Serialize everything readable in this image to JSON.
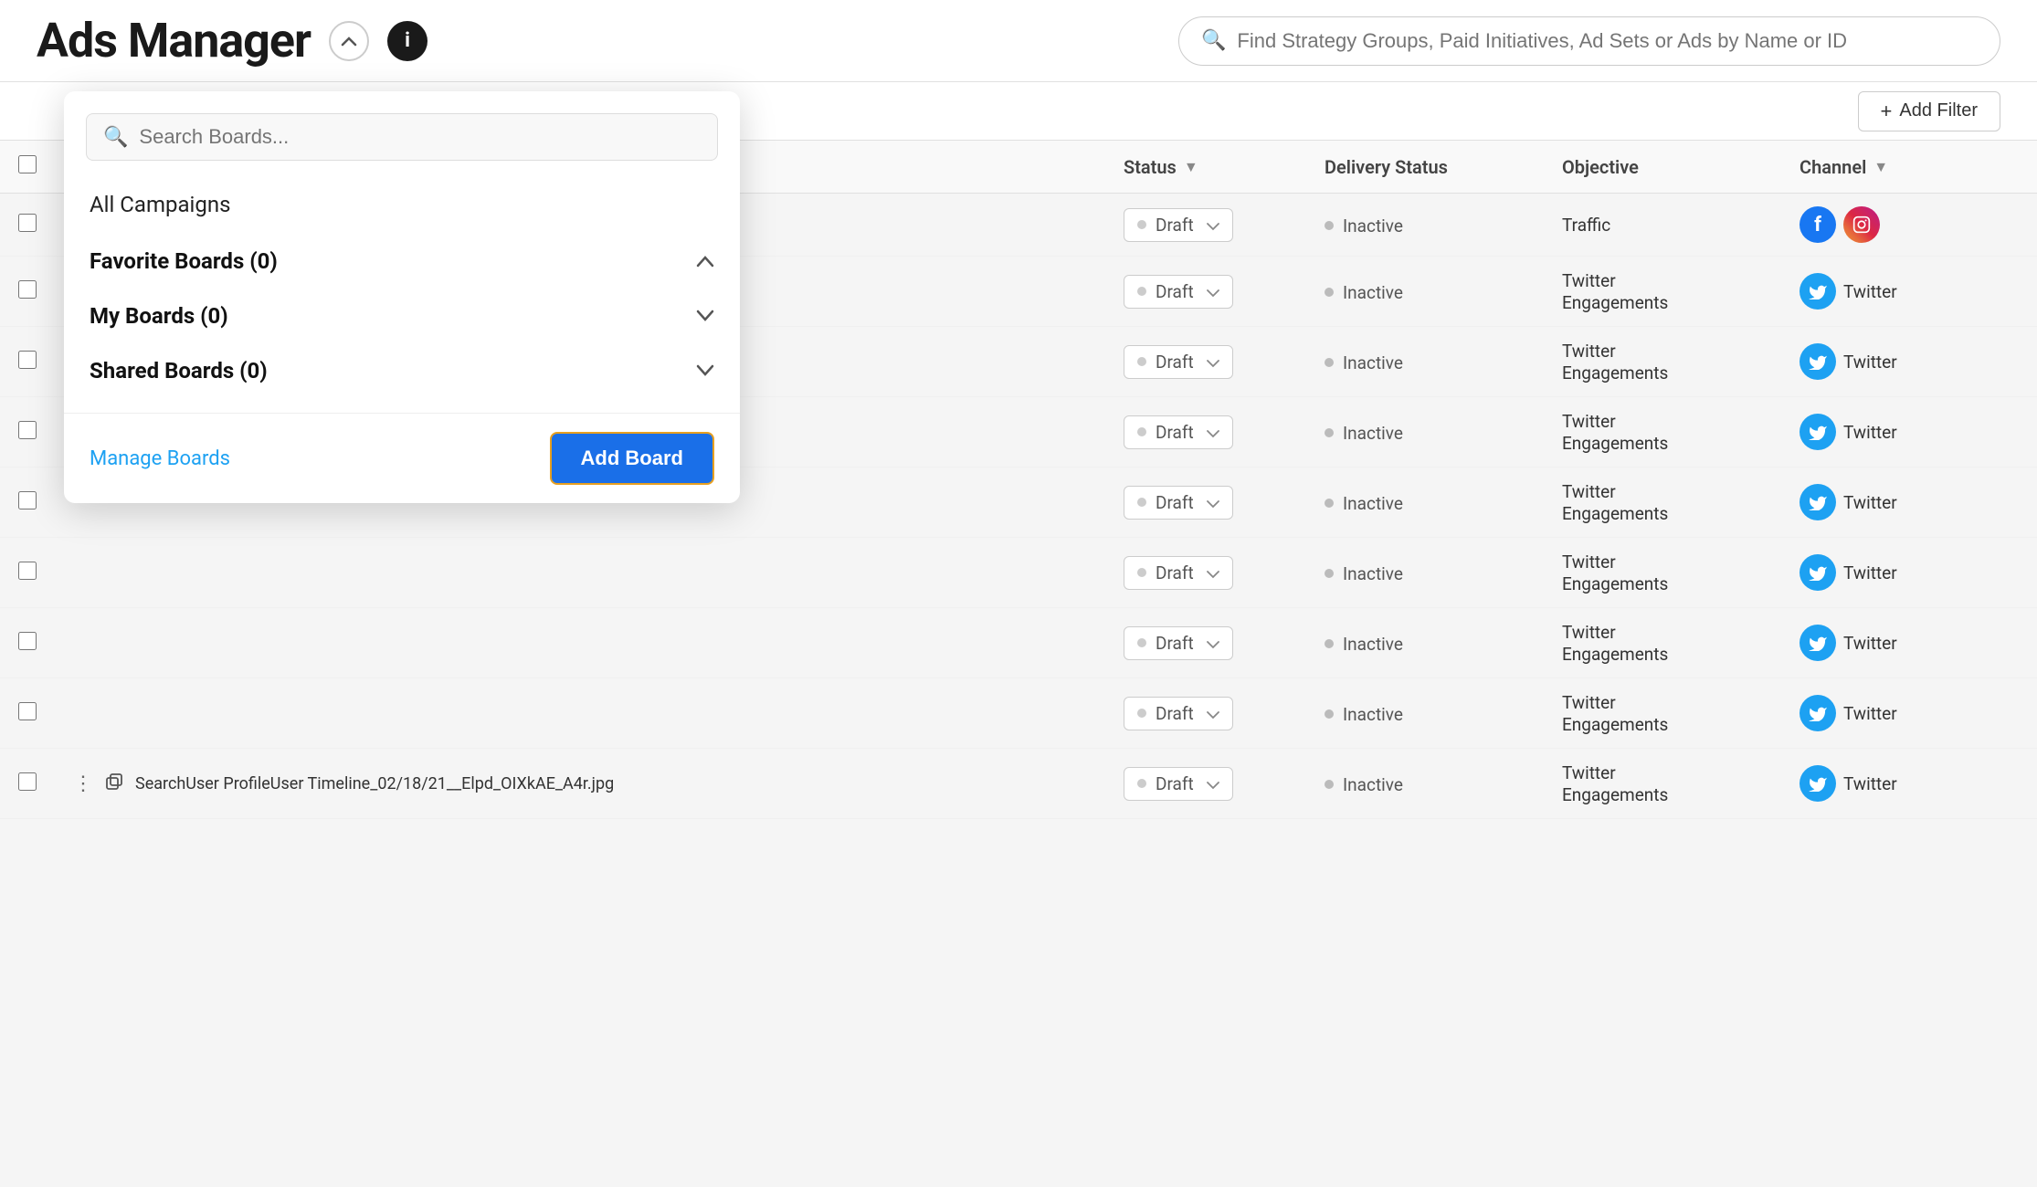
{
  "header": {
    "title": "Ads Manager",
    "search_placeholder": "Find Strategy Groups, Paid Initiatives, Ad Sets or Ads by Name or ID"
  },
  "dropdown": {
    "search_placeholder": "Search Boards...",
    "all_campaigns_label": "All Campaigns",
    "sections": [
      {
        "label": "Favorite Boards (0)",
        "chevron": "up",
        "count": 0
      },
      {
        "label": "My Boards (0)",
        "chevron": "down",
        "count": 0
      },
      {
        "label": "Shared Boards (0)",
        "chevron": "down",
        "count": 0
      }
    ],
    "manage_boards_label": "Manage Boards",
    "add_board_label": "Add Board"
  },
  "filters_bar": {
    "add_filter_label": "Add Filter"
  },
  "table": {
    "columns": [
      {
        "key": "checkbox",
        "label": ""
      },
      {
        "key": "name",
        "label": ""
      },
      {
        "key": "status",
        "label": "Status",
        "sortable": true
      },
      {
        "key": "delivery",
        "label": "Delivery Status",
        "sortable": false
      },
      {
        "key": "objective",
        "label": "Objective",
        "sortable": false
      },
      {
        "key": "channel",
        "label": "Channel",
        "sortable": true
      }
    ],
    "rows": [
      {
        "id": 1,
        "name": "",
        "status": "Draft",
        "delivery": "Inactive",
        "objective": "Traffic",
        "channel": "facebook_instagram",
        "channel_label": ""
      },
      {
        "id": 2,
        "name": "",
        "status": "Draft",
        "delivery": "Inactive",
        "objective": "Twitter\nEngagements",
        "channel": "twitter",
        "channel_label": "Twitter"
      },
      {
        "id": 3,
        "name": "",
        "status": "Draft",
        "delivery": "Inactive",
        "objective": "Twitter\nEngagements",
        "channel": "twitter",
        "channel_label": "Twitter"
      },
      {
        "id": 4,
        "name": "",
        "status": "Draft",
        "delivery": "Inactive",
        "objective": "Twitter\nEngagements",
        "channel": "twitter",
        "channel_label": "Twitter"
      },
      {
        "id": 5,
        "name": "",
        "status": "Draft",
        "delivery": "Inactive",
        "objective": "Twitter\nEngagements",
        "channel": "twitter",
        "channel_label": "Twitter"
      },
      {
        "id": 6,
        "name": "",
        "status": "Draft",
        "delivery": "Inactive",
        "objective": "Twitter\nEngagements",
        "channel": "twitter",
        "channel_label": "Twitter"
      },
      {
        "id": 7,
        "name": "",
        "status": "Draft",
        "delivery": "Inactive",
        "objective": "Twitter\nEngagements",
        "channel": "twitter",
        "channel_label": "Twitter"
      },
      {
        "id": 8,
        "name": "",
        "status": "Draft",
        "delivery": "Inactive",
        "objective": "Twitter\nEngagements",
        "channel": "twitter",
        "channel_label": "Twitter"
      },
      {
        "id": 9,
        "name": "SearchUser ProfileUser Timeline_02/18/21__Elpd_OIXkAE_A4r.jpg",
        "status": "Draft",
        "delivery": "Inactive",
        "objective": "Twitter\nEngagements",
        "channel": "twitter",
        "channel_label": "Twitter"
      }
    ]
  }
}
